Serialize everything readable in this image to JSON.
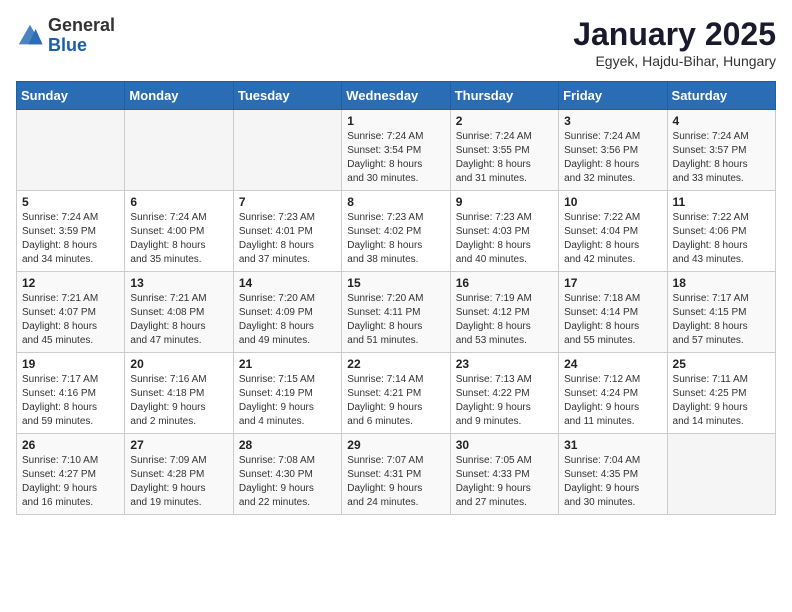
{
  "header": {
    "logo_general": "General",
    "logo_blue": "Blue",
    "title": "January 2025",
    "subtitle": "Egyek, Hajdu-Bihar, Hungary"
  },
  "weekdays": [
    "Sunday",
    "Monday",
    "Tuesday",
    "Wednesday",
    "Thursday",
    "Friday",
    "Saturday"
  ],
  "weeks": [
    [
      {
        "day": "",
        "info": ""
      },
      {
        "day": "",
        "info": ""
      },
      {
        "day": "",
        "info": ""
      },
      {
        "day": "1",
        "info": "Sunrise: 7:24 AM\nSunset: 3:54 PM\nDaylight: 8 hours\nand 30 minutes."
      },
      {
        "day": "2",
        "info": "Sunrise: 7:24 AM\nSunset: 3:55 PM\nDaylight: 8 hours\nand 31 minutes."
      },
      {
        "day": "3",
        "info": "Sunrise: 7:24 AM\nSunset: 3:56 PM\nDaylight: 8 hours\nand 32 minutes."
      },
      {
        "day": "4",
        "info": "Sunrise: 7:24 AM\nSunset: 3:57 PM\nDaylight: 8 hours\nand 33 minutes."
      }
    ],
    [
      {
        "day": "5",
        "info": "Sunrise: 7:24 AM\nSunset: 3:59 PM\nDaylight: 8 hours\nand 34 minutes."
      },
      {
        "day": "6",
        "info": "Sunrise: 7:24 AM\nSunset: 4:00 PM\nDaylight: 8 hours\nand 35 minutes."
      },
      {
        "day": "7",
        "info": "Sunrise: 7:23 AM\nSunset: 4:01 PM\nDaylight: 8 hours\nand 37 minutes."
      },
      {
        "day": "8",
        "info": "Sunrise: 7:23 AM\nSunset: 4:02 PM\nDaylight: 8 hours\nand 38 minutes."
      },
      {
        "day": "9",
        "info": "Sunrise: 7:23 AM\nSunset: 4:03 PM\nDaylight: 8 hours\nand 40 minutes."
      },
      {
        "day": "10",
        "info": "Sunrise: 7:22 AM\nSunset: 4:04 PM\nDaylight: 8 hours\nand 42 minutes."
      },
      {
        "day": "11",
        "info": "Sunrise: 7:22 AM\nSunset: 4:06 PM\nDaylight: 8 hours\nand 43 minutes."
      }
    ],
    [
      {
        "day": "12",
        "info": "Sunrise: 7:21 AM\nSunset: 4:07 PM\nDaylight: 8 hours\nand 45 minutes."
      },
      {
        "day": "13",
        "info": "Sunrise: 7:21 AM\nSunset: 4:08 PM\nDaylight: 8 hours\nand 47 minutes."
      },
      {
        "day": "14",
        "info": "Sunrise: 7:20 AM\nSunset: 4:09 PM\nDaylight: 8 hours\nand 49 minutes."
      },
      {
        "day": "15",
        "info": "Sunrise: 7:20 AM\nSunset: 4:11 PM\nDaylight: 8 hours\nand 51 minutes."
      },
      {
        "day": "16",
        "info": "Sunrise: 7:19 AM\nSunset: 4:12 PM\nDaylight: 8 hours\nand 53 minutes."
      },
      {
        "day": "17",
        "info": "Sunrise: 7:18 AM\nSunset: 4:14 PM\nDaylight: 8 hours\nand 55 minutes."
      },
      {
        "day": "18",
        "info": "Sunrise: 7:17 AM\nSunset: 4:15 PM\nDaylight: 8 hours\nand 57 minutes."
      }
    ],
    [
      {
        "day": "19",
        "info": "Sunrise: 7:17 AM\nSunset: 4:16 PM\nDaylight: 8 hours\nand 59 minutes."
      },
      {
        "day": "20",
        "info": "Sunrise: 7:16 AM\nSunset: 4:18 PM\nDaylight: 9 hours\nand 2 minutes."
      },
      {
        "day": "21",
        "info": "Sunrise: 7:15 AM\nSunset: 4:19 PM\nDaylight: 9 hours\nand 4 minutes."
      },
      {
        "day": "22",
        "info": "Sunrise: 7:14 AM\nSunset: 4:21 PM\nDaylight: 9 hours\nand 6 minutes."
      },
      {
        "day": "23",
        "info": "Sunrise: 7:13 AM\nSunset: 4:22 PM\nDaylight: 9 hours\nand 9 minutes."
      },
      {
        "day": "24",
        "info": "Sunrise: 7:12 AM\nSunset: 4:24 PM\nDaylight: 9 hours\nand 11 minutes."
      },
      {
        "day": "25",
        "info": "Sunrise: 7:11 AM\nSunset: 4:25 PM\nDaylight: 9 hours\nand 14 minutes."
      }
    ],
    [
      {
        "day": "26",
        "info": "Sunrise: 7:10 AM\nSunset: 4:27 PM\nDaylight: 9 hours\nand 16 minutes."
      },
      {
        "day": "27",
        "info": "Sunrise: 7:09 AM\nSunset: 4:28 PM\nDaylight: 9 hours\nand 19 minutes."
      },
      {
        "day": "28",
        "info": "Sunrise: 7:08 AM\nSunset: 4:30 PM\nDaylight: 9 hours\nand 22 minutes."
      },
      {
        "day": "29",
        "info": "Sunrise: 7:07 AM\nSunset: 4:31 PM\nDaylight: 9 hours\nand 24 minutes."
      },
      {
        "day": "30",
        "info": "Sunrise: 7:05 AM\nSunset: 4:33 PM\nDaylight: 9 hours\nand 27 minutes."
      },
      {
        "day": "31",
        "info": "Sunrise: 7:04 AM\nSunset: 4:35 PM\nDaylight: 9 hours\nand 30 minutes."
      },
      {
        "day": "",
        "info": ""
      }
    ]
  ]
}
